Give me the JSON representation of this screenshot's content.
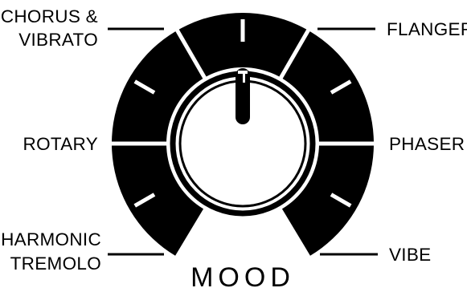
{
  "control": {
    "title": "MOOD",
    "options": [
      {
        "id": "chorus-vibrato",
        "lines": [
          "CHORUS &",
          "VIBRATO"
        ]
      },
      {
        "id": "flanger",
        "lines": [
          "FLANGER"
        ]
      },
      {
        "id": "rotary",
        "lines": [
          "ROTARY"
        ]
      },
      {
        "id": "phaser",
        "lines": [
          "PHASER"
        ]
      },
      {
        "id": "harmonic-tremolo",
        "lines": [
          "HARMONIC",
          "TREMOLO"
        ]
      },
      {
        "id": "vibe",
        "lines": [
          "VIBE"
        ]
      }
    ]
  },
  "colors": {
    "ink": "#000000",
    "paper": "#ffffff"
  }
}
